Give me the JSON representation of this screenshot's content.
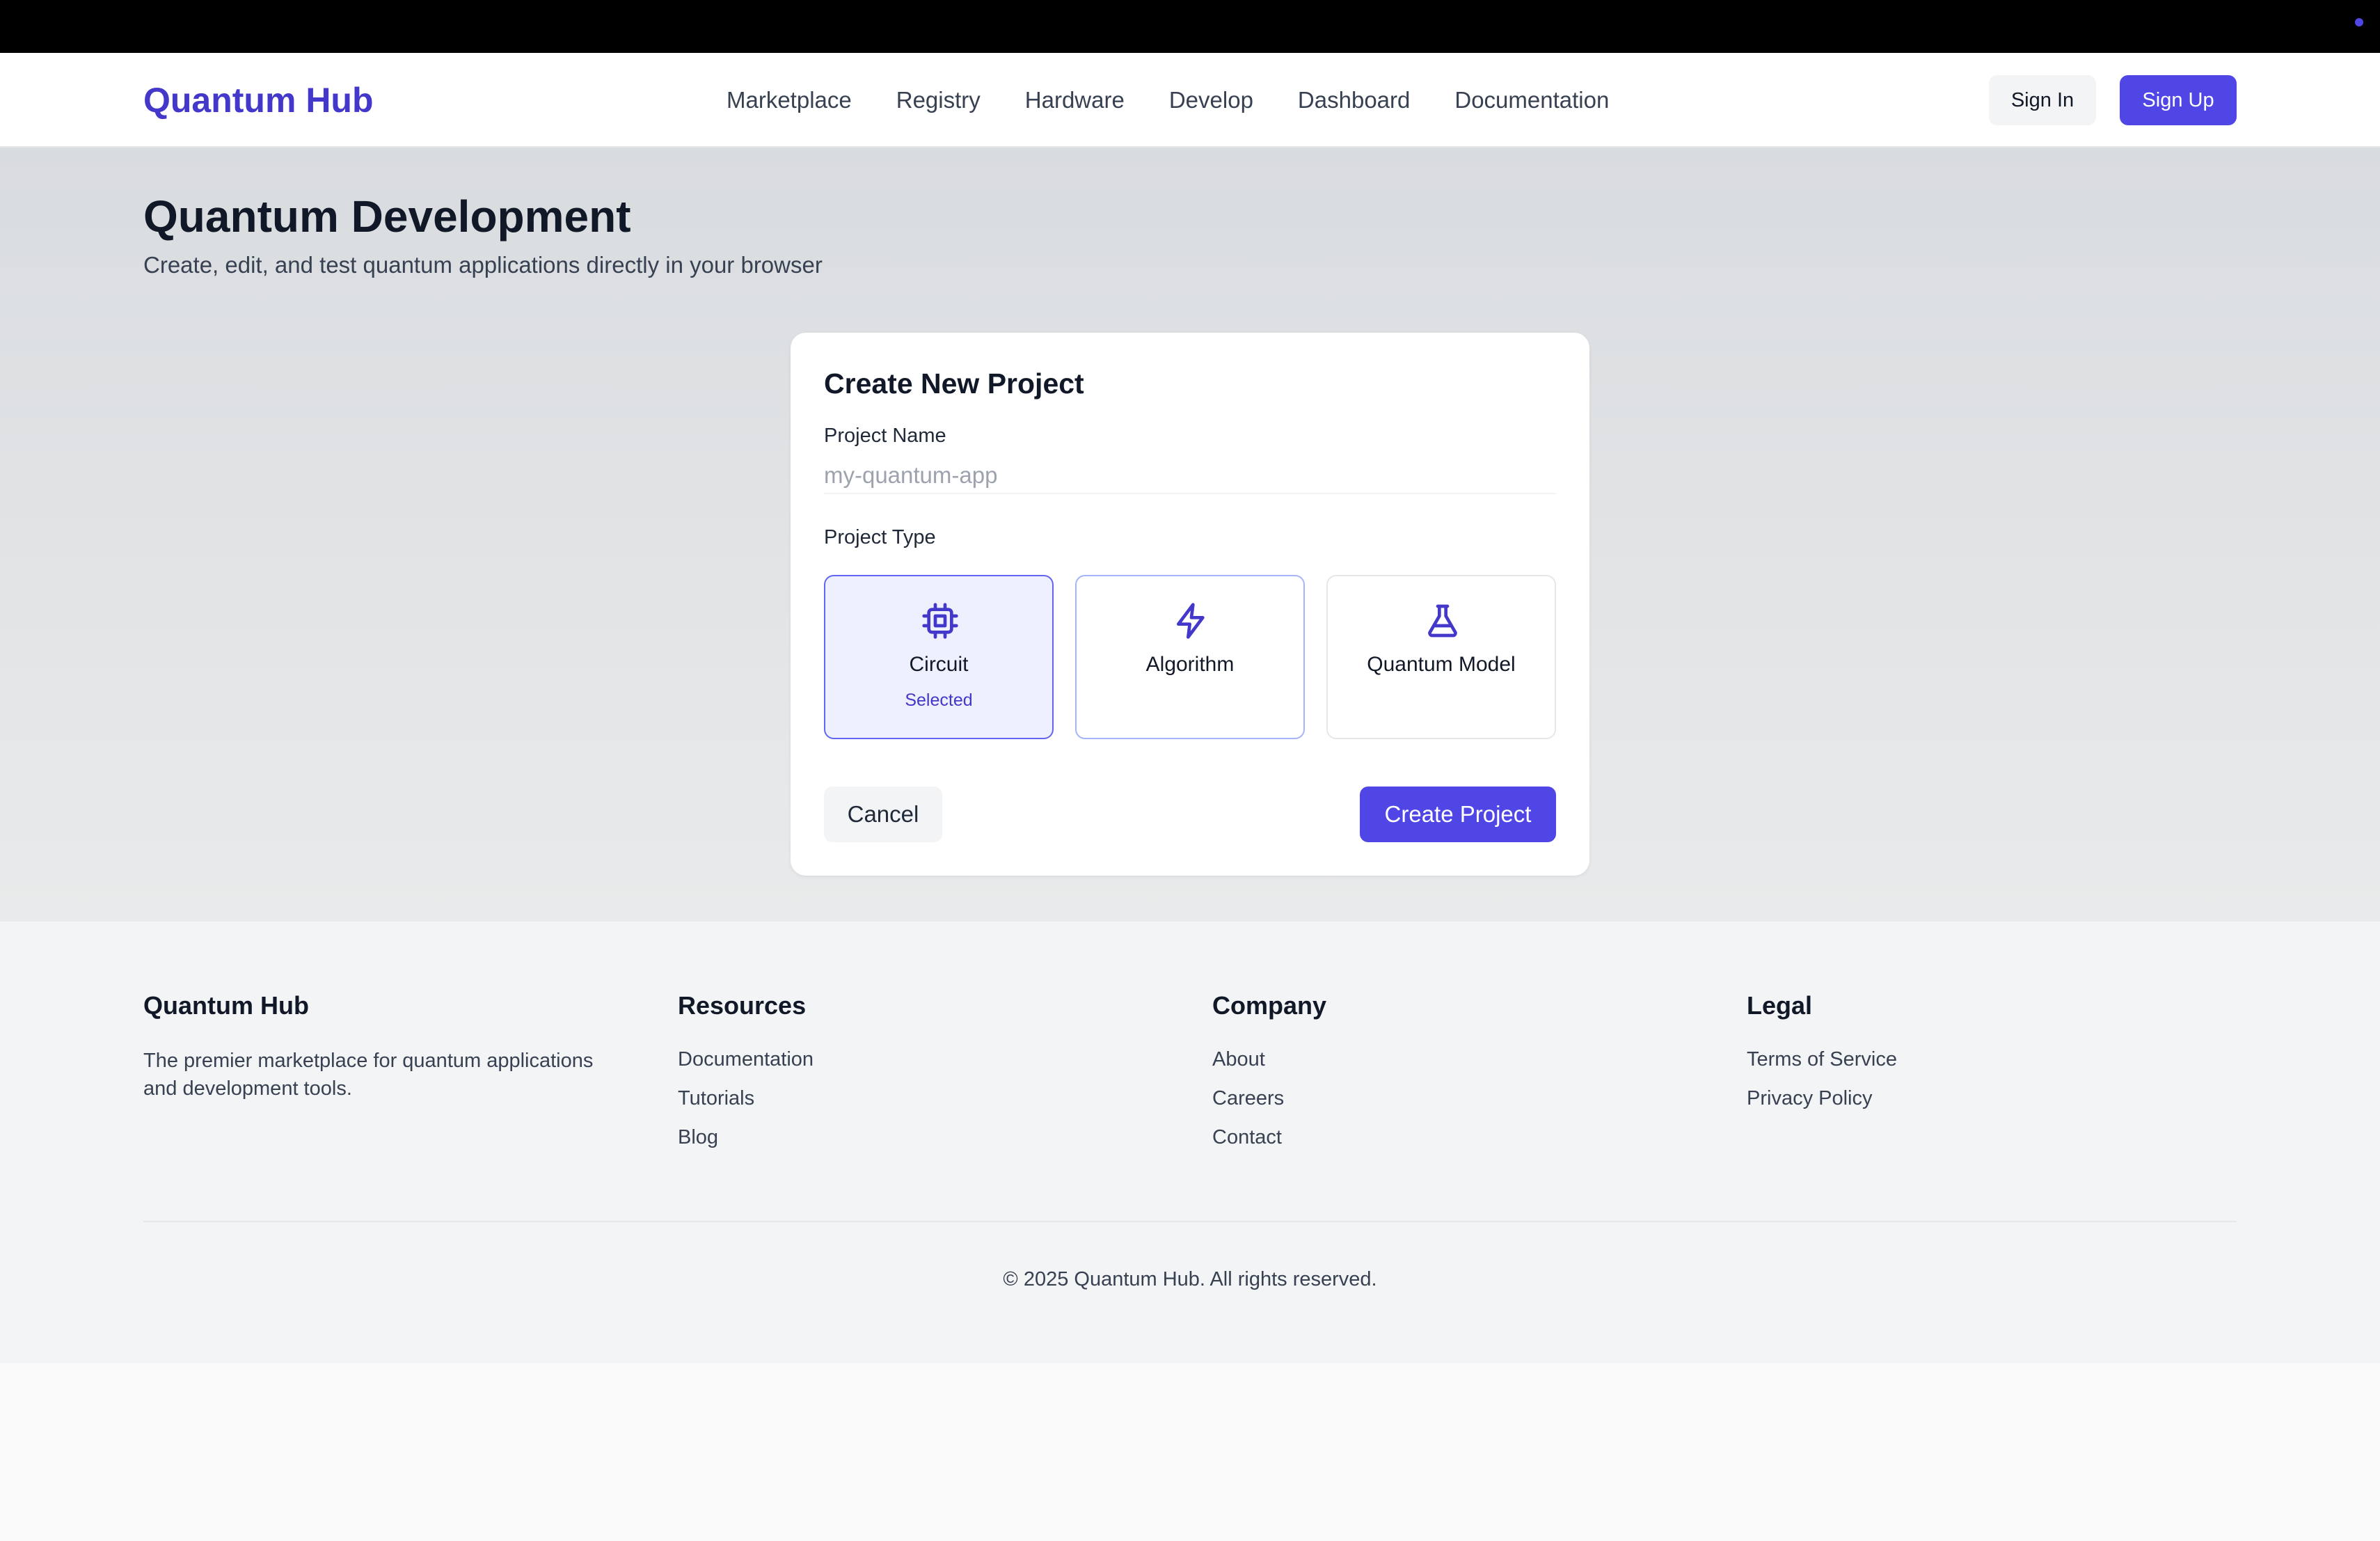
{
  "header": {
    "brand": "Quantum Hub",
    "nav": [
      "Marketplace",
      "Registry",
      "Hardware",
      "Develop",
      "Dashboard",
      "Documentation"
    ],
    "sign_in": "Sign In",
    "sign_up": "Sign Up"
  },
  "hero": {
    "title": "Quantum Development",
    "subtitle": "Create, edit, and test quantum applications directly in your browser"
  },
  "form": {
    "title": "Create New Project",
    "name_label": "Project Name",
    "name_placeholder": "my-quantum-app",
    "name_value": "",
    "type_label": "Project Type",
    "types": [
      {
        "name": "Circuit",
        "status": "Selected",
        "icon": "chip-icon",
        "selected": true
      },
      {
        "name": "Algorithm",
        "status": "",
        "icon": "lightning-icon",
        "selected": false
      },
      {
        "name": "Quantum Model",
        "status": "",
        "icon": "flask-icon",
        "selected": false
      }
    ],
    "cancel": "Cancel",
    "create": "Create Project"
  },
  "footer": {
    "brand": {
      "title": "Quantum Hub",
      "description": "The premier marketplace for quantum applications and development tools."
    },
    "resources": {
      "title": "Resources",
      "links": [
        "Documentation",
        "Tutorials",
        "Blog"
      ]
    },
    "company": {
      "title": "Company",
      "links": [
        "About",
        "Careers",
        "Contact"
      ]
    },
    "legal": {
      "title": "Legal",
      "links": [
        "Terms of Service",
        "Privacy Policy"
      ]
    },
    "copyright": "© 2025 Quantum Hub. All rights reserved."
  },
  "colors": {
    "accent": "#4f46e5",
    "brand": "#4338ca",
    "selected_bg": "#eef0fd"
  }
}
